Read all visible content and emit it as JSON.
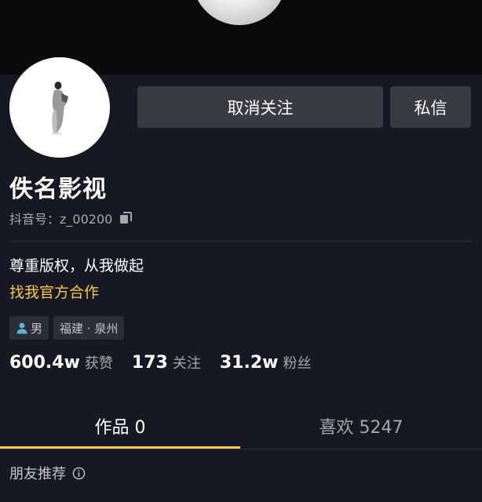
{
  "profile": {
    "name": "佚名影视",
    "douyin_id_label": "抖音号：",
    "douyin_id": "z_00200",
    "bio": "尊重版权，从我做起",
    "link_text": "找我官方合作",
    "tags": {
      "gender": "男",
      "location": "福建 · 泉州"
    }
  },
  "actions": {
    "unfollow_label": "取消关注",
    "message_label": "私信"
  },
  "stats": {
    "likes_value": "600.4w",
    "likes_label": "获赞",
    "following_value": "173",
    "following_label": "关注",
    "followers_value": "31.2w",
    "followers_label": "粉丝"
  },
  "tabs": {
    "works": "作品 0",
    "likes": "喜欢 5247"
  },
  "section": {
    "friends_label": "朋友推荐"
  },
  "colors": {
    "background": "#161823",
    "accent": "#f9ca3b",
    "button": "#393b44",
    "secondary_text": "#a6a7ab"
  }
}
